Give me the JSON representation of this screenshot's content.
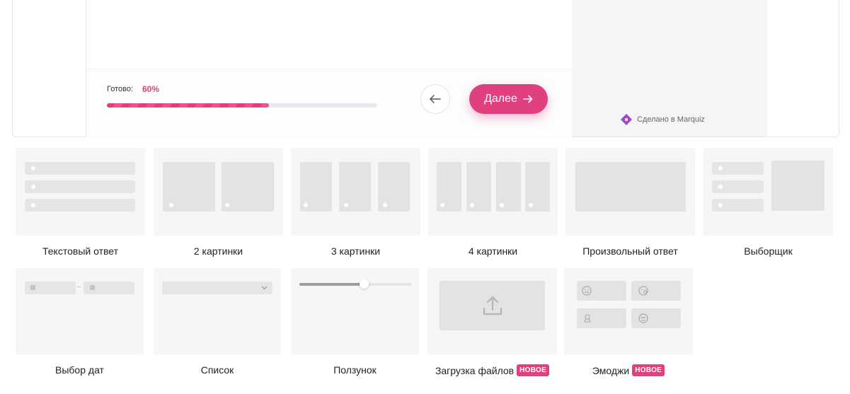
{
  "preview": {
    "progress_label": "Готово:",
    "progress_value": "60%",
    "progress_fraction": 0.6,
    "next_label": "Далее",
    "made_in": "Сделано в Marquiz"
  },
  "tiles": {
    "text_answer": "Текстовый ответ",
    "two_images": "2 картинки",
    "three_images": "3 картинки",
    "four_images": "4 картинки",
    "free_answer": "Произвольный ответ",
    "selector": "Выборщик",
    "date_picker": "Выбор дат",
    "list": "Список",
    "slider": "Ползунок",
    "file_upload": "Загрузка файлов",
    "emoji": "Эмоджи",
    "new_badge": "НОВОЕ"
  },
  "colors": {
    "accent": "#e0407f",
    "tile_bg": "#f6f6f6",
    "placeholder": "#e3e3e3"
  },
  "icons": [
    "arrow-left-icon",
    "arrow-right-icon",
    "marquiz-logo-icon",
    "upload-icon",
    "chevron-down-icon",
    "smile-icon",
    "emoji-icon"
  ]
}
